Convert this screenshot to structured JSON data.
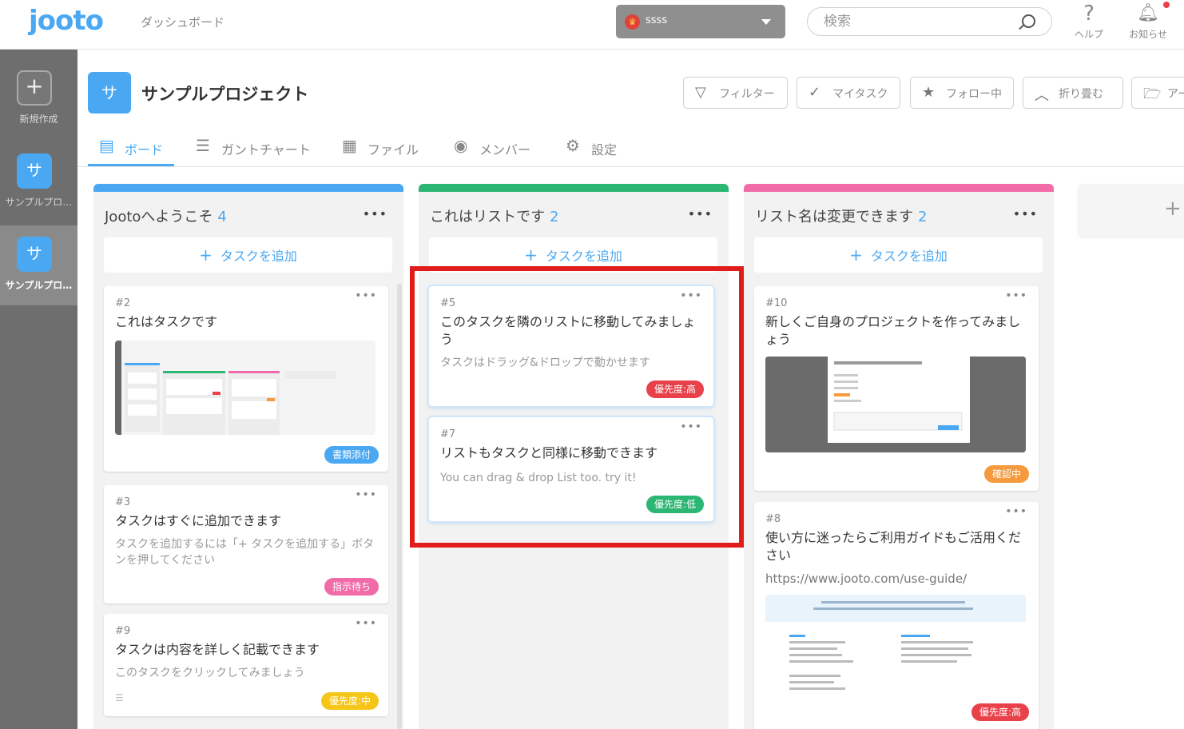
{
  "header": {
    "logo": "jooto",
    "dashboard_link": "ダッシュボード",
    "user_name": "ssss",
    "search_placeholder": "検索",
    "help_label": "ヘルプ",
    "notice_label": "お知らせ"
  },
  "sidebar": {
    "new_label": "新規作成",
    "projects": [
      {
        "initial": "サ",
        "label": "サンプルプロ…"
      },
      {
        "initial": "サ",
        "label": "サンプルプロ…"
      }
    ]
  },
  "project": {
    "initial": "サ",
    "title": "サンプルプロジェクト"
  },
  "toolbar": {
    "filter": "フィルター",
    "my_task": "マイタスク",
    "following": "フォロー中",
    "collapse": "折り畳む",
    "archive": "アー"
  },
  "tabs": [
    {
      "label": "ボード"
    },
    {
      "label": "ガントチャート"
    },
    {
      "label": "ファイル"
    },
    {
      "label": "メンバー"
    },
    {
      "label": "設定"
    }
  ],
  "add_task_label": "タスクを追加",
  "lists": [
    {
      "name": "Jootoへようこそ",
      "count": "4",
      "color": "#4aa8f2",
      "cards": [
        {
          "num": "#2",
          "title": "これはタスクです",
          "desc": "",
          "badge": "書類添付",
          "badge_color": "#4aa8f2"
        },
        {
          "num": "#3",
          "title": "タスクはすぐに追加できます",
          "desc": "タスクを追加するには「+ タスクを追加する」ボタンを押してください",
          "badge": "指示待ち",
          "badge_color": "#f06ba8"
        },
        {
          "num": "#9",
          "title": "タスクは内容を詳しく記載できます",
          "desc": "このタスクをクリックしてみましょう",
          "badge": "優先度:中",
          "badge_color": "#f5c518"
        }
      ]
    },
    {
      "name": "これはリストです",
      "count": "2",
      "color": "#2bb673",
      "cards": [
        {
          "num": "#5",
          "title": "このタスクを隣のリストに移動してみましょう",
          "desc": "タスクはドラッグ&ドロップで動かせます",
          "badge": "優先度:高",
          "badge_color": "#e9414a"
        },
        {
          "num": "#7",
          "title": "リストもタスクと同様に移動できます",
          "desc": "You can drag & drop List too. try it!",
          "badge": "優先度:低",
          "badge_color": "#2bb673"
        }
      ]
    },
    {
      "name": "リスト名は変更できます",
      "count": "2",
      "color": "#f06ba8",
      "cards": [
        {
          "num": "#10",
          "title": "新しくご自身のプロジェクトを作ってみましょう",
          "desc": "",
          "badge": "確認中",
          "badge_color": "#f59a3d"
        },
        {
          "num": "#8",
          "title": "使い方に迷ったらご利用ガイドもご活用ください",
          "desc": "https://www.jooto.com/use-guide/",
          "badge": "優先度:高",
          "badge_color": "#e9414a"
        }
      ]
    }
  ],
  "colors": {
    "accent": "#4aa8f2",
    "highlight": "#e21b1b"
  }
}
